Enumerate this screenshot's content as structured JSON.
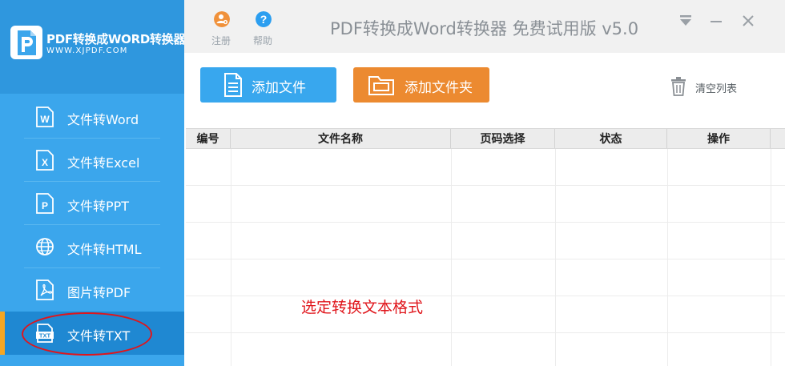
{
  "sidebar": {
    "logo_title": "PDF转换成WORD转换器",
    "logo_url": "WWW.XJPDF.COM",
    "items": [
      {
        "label": "文件转Word",
        "icon": "word-doc-icon"
      },
      {
        "label": "文件转Excel",
        "icon": "excel-doc-icon"
      },
      {
        "label": "文件转PPT",
        "icon": "ppt-doc-icon"
      },
      {
        "label": "文件转HTML",
        "icon": "globe-icon"
      },
      {
        "label": "图片转PDF",
        "icon": "pdf-doc-icon"
      },
      {
        "label": "文件转TXT",
        "icon": "txt-doc-icon",
        "active": true
      }
    ]
  },
  "titlebar": {
    "register_label": "注册",
    "help_label": "帮助",
    "title": "PDF转换成Word转换器 免费试用版 v5.0"
  },
  "toolbar": {
    "add_file_label": "添加文件",
    "add_folder_label": "添加文件夹",
    "clear_label": "清空列表"
  },
  "table": {
    "columns": [
      "编号",
      "文件名称",
      "页码选择",
      "状态",
      "操作"
    ],
    "rows": []
  },
  "annotation": "选定转换文本格式",
  "colors": {
    "sidebar": "#3ba6ec",
    "active_item": "#1f88d2",
    "accent": "#f5a623",
    "add_file_button": "#38a7ee",
    "add_folder_button": "#ec8a30",
    "annotation": "#e0151b"
  }
}
